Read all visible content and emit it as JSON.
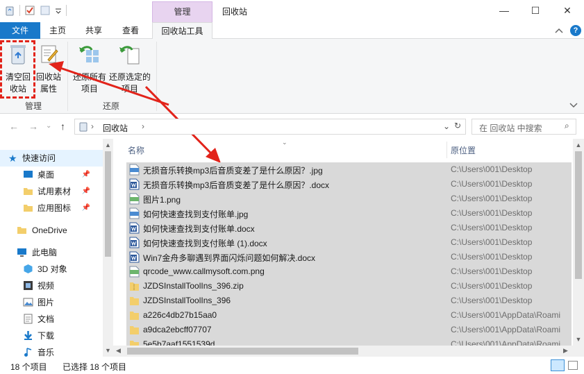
{
  "window": {
    "context_tab": "管理",
    "title": "回收站",
    "minimize": "—",
    "maximize": "☐",
    "close": "✕"
  },
  "tabs": {
    "file": "文件",
    "home": "主页",
    "share": "共享",
    "view": "查看",
    "recycle_tools": "回收站工具",
    "help": "?"
  },
  "ribbon": {
    "empty_label": "清空回收站",
    "props_label": "回收站属性",
    "restore_all_label": "还原所有项目",
    "restore_selected_label": "还原选定的项目",
    "group_manage": "管理",
    "group_restore": "还原"
  },
  "address": {
    "path": "回收站",
    "search_placeholder": "在 回收站 中搜索"
  },
  "nav": {
    "quick_access": "快速访问",
    "desktop": "桌面",
    "test_material": "试用素材",
    "app_icons": "应用图标",
    "onedrive": "OneDrive",
    "this_pc": "此电脑",
    "objects3d": "3D 对象",
    "video": "视频",
    "pictures": "图片",
    "documents": "文档",
    "downloads": "下载",
    "music": "音乐"
  },
  "columns": {
    "name": "名称",
    "location": "原位置"
  },
  "files": [
    {
      "name": "无损音乐转换mp3后音质变差了是什么原因？.jpg",
      "location": "C:\\Users\\001\\Desktop",
      "icon": "jpg-icon"
    },
    {
      "name": "无损音乐转换mp3后音质变差了是什么原因？.docx",
      "location": "C:\\Users\\001\\Desktop",
      "icon": "word-icon"
    },
    {
      "name": "图片1.png",
      "location": "C:\\Users\\001\\Desktop",
      "icon": "png-icon"
    },
    {
      "name": "如何快速查找到支付账单.jpg",
      "location": "C:\\Users\\001\\Desktop",
      "icon": "jpg-icon"
    },
    {
      "name": "如何快速查找到支付账单.docx",
      "location": "C:\\Users\\001\\Desktop",
      "icon": "word-icon"
    },
    {
      "name": "如何快速查找到支付账单 (1).docx",
      "location": "C:\\Users\\001\\Desktop",
      "icon": "word-icon"
    },
    {
      "name": "Win7金舟多聊遇到界面闪烁问题如何解决.docx",
      "location": "C:\\Users\\001\\Desktop",
      "icon": "word-icon"
    },
    {
      "name": "qrcode_www.callmysoft.com.png",
      "location": "C:\\Users\\001\\Desktop",
      "icon": "png-icon"
    },
    {
      "name": "JZDSInstallToolIns_396.zip",
      "location": "C:\\Users\\001\\Desktop",
      "icon": "zip-icon"
    },
    {
      "name": "JZDSInstallToolIns_396",
      "location": "C:\\Users\\001\\Desktop",
      "icon": "folder-icon"
    },
    {
      "name": "a226c4db27b15aa0",
      "location": "C:\\Users\\001\\AppData\\Roami",
      "icon": "folder-icon"
    },
    {
      "name": "a9dca2ebcff07707",
      "location": "C:\\Users\\001\\AppData\\Roami",
      "icon": "folder-icon"
    },
    {
      "name": "5e5b7aaf1551539d",
      "location": "C:\\Users\\001\\AppData\\Roami",
      "icon": "folder-icon"
    }
  ],
  "status": {
    "count": "18 个项目",
    "selected": "已选择 18 个项目"
  },
  "colors": {
    "accent": "#1979ca",
    "context_tab": "#e8d4f0",
    "selection": "#d9d9d9",
    "annotation": "#e2231a"
  }
}
